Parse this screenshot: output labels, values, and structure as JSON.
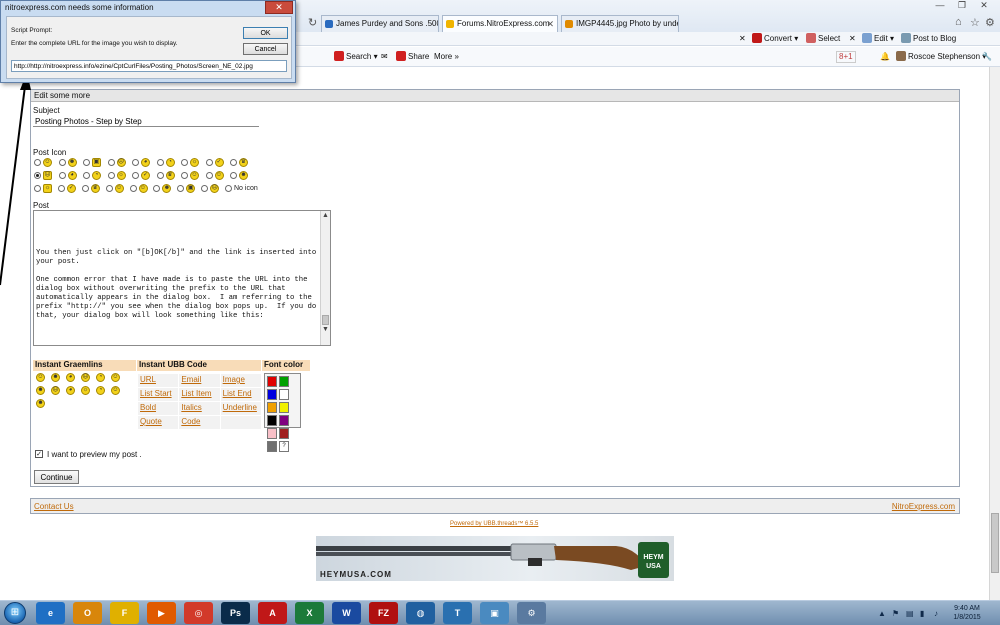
{
  "browser": {
    "tabs": [
      {
        "label": "James Purdey and Sons .500 B...",
        "fav": "#2a6bbf",
        "active": false
      },
      {
        "label": "Forums.NitroExpress.com",
        "fav": "#f0b400",
        "active": true
      },
      {
        "label": "IMGP4445.jpg Photo by underl...",
        "fav": "#e08a00",
        "active": false
      }
    ],
    "command_bar": {
      "convert": "Convert",
      "select": "Select",
      "edit": "Edit",
      "post_to_blog": "Post to Blog"
    },
    "toolbar": {
      "search": "Search",
      "share": "Share",
      "more": "More",
      "google_plus": "8+1",
      "user": "Roscoe Stephenson"
    }
  },
  "dialog": {
    "title": "nitroexpress.com needs some information",
    "script_prompt": "Script Prompt:",
    "message": "Enter the complete URL for the image you wish to display.",
    "ok": "OK",
    "cancel": "Cancel",
    "url_value": "http://http://nitroexpress.info/ezine/CptCurlFiles/Posting_Photos/Screen_NE_02.jpg"
  },
  "form": {
    "header": "Edit some more",
    "subject_label": "Subject",
    "subject_value": "Posting Photos - Step by Step",
    "post_icon_label": "Post Icon",
    "no_icon": "No icon",
    "post_label": "Post",
    "post_text": "\n\n\n\nYou then just click on \"[b]OK[/b]\" and the link is inserted into your post.\n\nOne common error that I have made is to paste the URL into the dialog box without overwriting the prefix to the URL that automatically appears in the dialog box.  I am referring to the prefix \"http://\" you see when the dialog box pops up.  If you do that, your dialog box will look something like this:",
    "graemlins_header": "Instant Graemlins",
    "ubb_header": "Instant UBB Code",
    "font_color_header": "Font color",
    "ubb_codes": [
      [
        "URL",
        "Email",
        "Image"
      ],
      [
        "List Start",
        "List Item",
        "List End"
      ],
      [
        "Bold",
        "Italics",
        "Underline"
      ],
      [
        "Quote",
        "Code",
        ""
      ]
    ],
    "font_colors": [
      "#e00000",
      "#00a000",
      "#0000e0",
      "#ffffff",
      "#f0a000",
      "#f0f000",
      "#000000",
      "#800080",
      "#f8c0c8",
      "#a02020",
      "#707070"
    ],
    "help_glyph": "?",
    "preview_label": "I want to preview my post .",
    "continue": "Continue"
  },
  "footer": {
    "contact": "Contact Us",
    "site": "NitroExpress.com",
    "powered_by": "Powered by UBB.threads™ 6.5.5",
    "banner_url": "HEYMUSA.COM",
    "banner_logo": "HEYM USA"
  },
  "taskbar": {
    "apps": [
      {
        "label": "e",
        "color": "#1f6fc4"
      },
      {
        "label": "O",
        "color": "#d8860b"
      },
      {
        "label": "F",
        "color": "#e0b000"
      },
      {
        "label": "▶",
        "color": "#e05a00"
      },
      {
        "label": "◎",
        "color": "#d23a2a"
      },
      {
        "label": "Ps",
        "color": "#0a2b4a"
      },
      {
        "label": "A",
        "color": "#c01818"
      },
      {
        "label": "X",
        "color": "#1c7a3a"
      },
      {
        "label": "W",
        "color": "#1a4aa0"
      },
      {
        "label": "FZ",
        "color": "#b01010"
      },
      {
        "label": "◍",
        "color": "#2060a0"
      },
      {
        "label": "T",
        "color": "#2a70b0"
      },
      {
        "label": "▣",
        "color": "#4a8ac0"
      },
      {
        "label": "⚙",
        "color": "#5a7aa0"
      }
    ],
    "time": "9:40 AM",
    "date": "1/8/2015"
  }
}
